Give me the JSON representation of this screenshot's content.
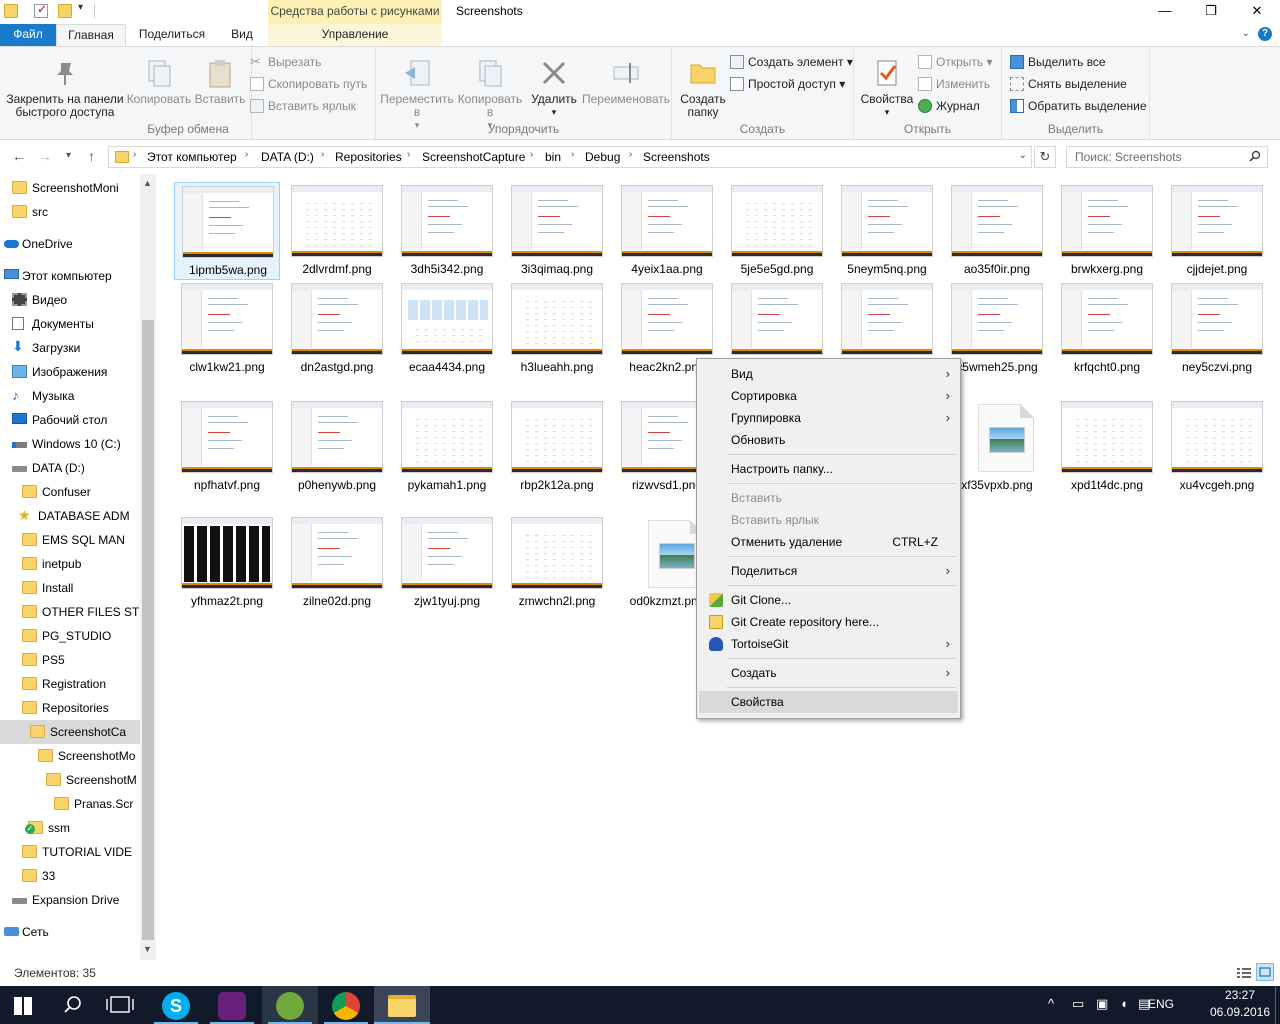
{
  "window": {
    "title": "Screenshots",
    "contextual_header": "Средства работы с рисунками"
  },
  "tabs": {
    "file": "Файл",
    "home": "Главная",
    "share": "Поделиться",
    "view": "Вид",
    "manage": "Управление"
  },
  "ribbon": {
    "clipboard": {
      "label": "Буфер обмена",
      "pin": "Закрепить на панели быстрого доступа",
      "copy": "Копировать",
      "paste": "Вставить",
      "cut": "Вырезать",
      "copy_path": "Скопировать путь",
      "paste_shortcut": "Вставить ярлык"
    },
    "organize": {
      "label": "Упорядочить",
      "move_to": "Переместить в",
      "copy_to": "Копировать в",
      "delete": "Удалить",
      "rename": "Переименовать"
    },
    "new": {
      "label": "Создать",
      "new_folder": "Создать папку",
      "new_item": "Создать элемент",
      "easy_access": "Простой доступ"
    },
    "open": {
      "label": "Открыть",
      "properties": "Свойства",
      "open": "Открыть",
      "edit": "Изменить",
      "history": "Журнал"
    },
    "select": {
      "label": "Выделить",
      "select_all": "Выделить все",
      "select_none": "Снять выделение",
      "invert": "Обратить выделение"
    }
  },
  "address": {
    "crumbs": [
      "Этот компьютер",
      "DATA (D:)",
      "Repositories",
      "ScreenshotCapture",
      "bin",
      "Debug",
      "Screenshots"
    ],
    "search_placeholder": "Поиск: Screenshots"
  },
  "nav": [
    {
      "label": "ScreenshotMoni",
      "icon": "folder-icon"
    },
    {
      "label": "src",
      "icon": "folder-icon"
    },
    {
      "label": "OneDrive",
      "icon": "onedrive-icon"
    },
    {
      "label": "Этот компьютер",
      "icon": "computer-icon"
    },
    {
      "label": "Видео",
      "icon": "video-icon"
    },
    {
      "label": "Документы",
      "icon": "documents-icon"
    },
    {
      "label": "Загрузки",
      "icon": "downloads-icon"
    },
    {
      "label": "Изображения",
      "icon": "pictures-icon"
    },
    {
      "label": "Музыка",
      "icon": "music-icon"
    },
    {
      "label": "Рабочий стол",
      "icon": "desktop-icon"
    },
    {
      "label": "Windows 10 (C:)",
      "icon": "windows-drive-icon"
    },
    {
      "label": "DATA (D:)",
      "icon": "drive-icon"
    },
    {
      "label": "Confuser",
      "icon": "folder-icon"
    },
    {
      "label": "DATABASE ADM",
      "icon": "star-folder-icon"
    },
    {
      "label": "EMS SQL MAN",
      "icon": "folder-icon"
    },
    {
      "label": "inetpub",
      "icon": "folder-icon"
    },
    {
      "label": "Install",
      "icon": "folder-icon"
    },
    {
      "label": "OTHER FILES ST",
      "icon": "folder-icon"
    },
    {
      "label": "PG_STUDIO",
      "icon": "folder-icon"
    },
    {
      "label": "PS5",
      "icon": "folder-icon"
    },
    {
      "label": "Registration",
      "icon": "folder-icon"
    },
    {
      "label": "Repositories",
      "icon": "folder-icon"
    },
    {
      "label": "ScreenshotCa",
      "icon": "folder-icon"
    },
    {
      "label": "ScreenshotMo",
      "icon": "folder-icon"
    },
    {
      "label": "ScreenshotM",
      "icon": "folder-icon"
    },
    {
      "label": "Pranas.Scr",
      "icon": "folder-icon"
    },
    {
      "label": "ssm",
      "icon": "git-folder-icon"
    },
    {
      "label": "TUTORIAL VIDE",
      "icon": "folder-icon"
    },
    {
      "label": "33",
      "icon": "folder-icon"
    },
    {
      "label": "Expansion Drive",
      "icon": "drive-icon"
    },
    {
      "label": "Сеть",
      "icon": "network-icon"
    }
  ],
  "files": [
    {
      "name": "1ipmb5wa.png",
      "kind": "screenshot"
    },
    {
      "name": "2dlvrdmf.png",
      "kind": "grid"
    },
    {
      "name": "3dh5i342.png",
      "kind": "screenshot"
    },
    {
      "name": "3i3qimaq.png",
      "kind": "screenshot"
    },
    {
      "name": "4yeix1aa.png",
      "kind": "screenshot"
    },
    {
      "name": "5je5e5gd.png",
      "kind": "grid"
    },
    {
      "name": "5neym5nq.png",
      "kind": "screenshot"
    },
    {
      "name": "ao35f0ir.png",
      "kind": "screenshot"
    },
    {
      "name": "brwkxerg.png",
      "kind": "screenshot"
    },
    {
      "name": "cjjdejet.png",
      "kind": "screenshot"
    },
    {
      "name": "clw1kw21.png",
      "kind": "screenshot"
    },
    {
      "name": "dn2astgd.png",
      "kind": "screenshot"
    },
    {
      "name": "ecaa4434.png",
      "kind": "blue"
    },
    {
      "name": "h3lueahh.png",
      "kind": "grid"
    },
    {
      "name": "heac2kn2.png",
      "kind": "screenshot"
    },
    {
      "name": "",
      "kind": "screenshot"
    },
    {
      "name": "",
      "kind": "screenshot"
    },
    {
      "name": "c5wmeh25.png",
      "kind": "screenshot"
    },
    {
      "name": "krfqcht0.png",
      "kind": "screenshot"
    },
    {
      "name": "ney5czvi.png",
      "kind": "screenshot"
    },
    {
      "name": "npfhatvf.png",
      "kind": "screenshot"
    },
    {
      "name": "p0henywb.png",
      "kind": "screenshot"
    },
    {
      "name": "pykamah1.png",
      "kind": "grid"
    },
    {
      "name": "rbp2k12a.png",
      "kind": "grid"
    },
    {
      "name": "rizwvsd1.png",
      "kind": "screenshot"
    },
    {
      "name": "",
      "kind": "screenshot"
    },
    {
      "name": "",
      "kind": "screenshot"
    },
    {
      "name": "xf35vpxb.png",
      "kind": "generic"
    },
    {
      "name": "xpd1t4dc.png",
      "kind": "grid"
    },
    {
      "name": "xu4vcgeh.png",
      "kind": "grid"
    },
    {
      "name": "yfhmaz2t.png",
      "kind": "dark"
    },
    {
      "name": "zilne02d.png",
      "kind": "screenshot"
    },
    {
      "name": "zjw1tyuj.png",
      "kind": "screenshot"
    },
    {
      "name": "zmwchn2l.png",
      "kind": "grid"
    },
    {
      "name": "od0kzmzt.png",
      "kind": "generic"
    }
  ],
  "context_menu": {
    "view": "Вид",
    "sort": "Сортировка",
    "group": "Группировка",
    "refresh": "Обновить",
    "customize": "Настроить папку...",
    "paste": "Вставить",
    "paste_shortcut": "Вставить ярлык",
    "undo_delete": "Отменить удаление",
    "undo_shortcut": "CTRL+Z",
    "share": "Поделиться",
    "git_clone": "Git Clone...",
    "git_create": "Git Create repository here...",
    "tortoisegit": "TortoiseGit",
    "new": "Создать",
    "properties": "Свойства"
  },
  "status": {
    "item_count": "Элементов: 35"
  },
  "taskbar": {
    "lang": "ENG",
    "time": "23:27",
    "date": "06.09.2016"
  }
}
